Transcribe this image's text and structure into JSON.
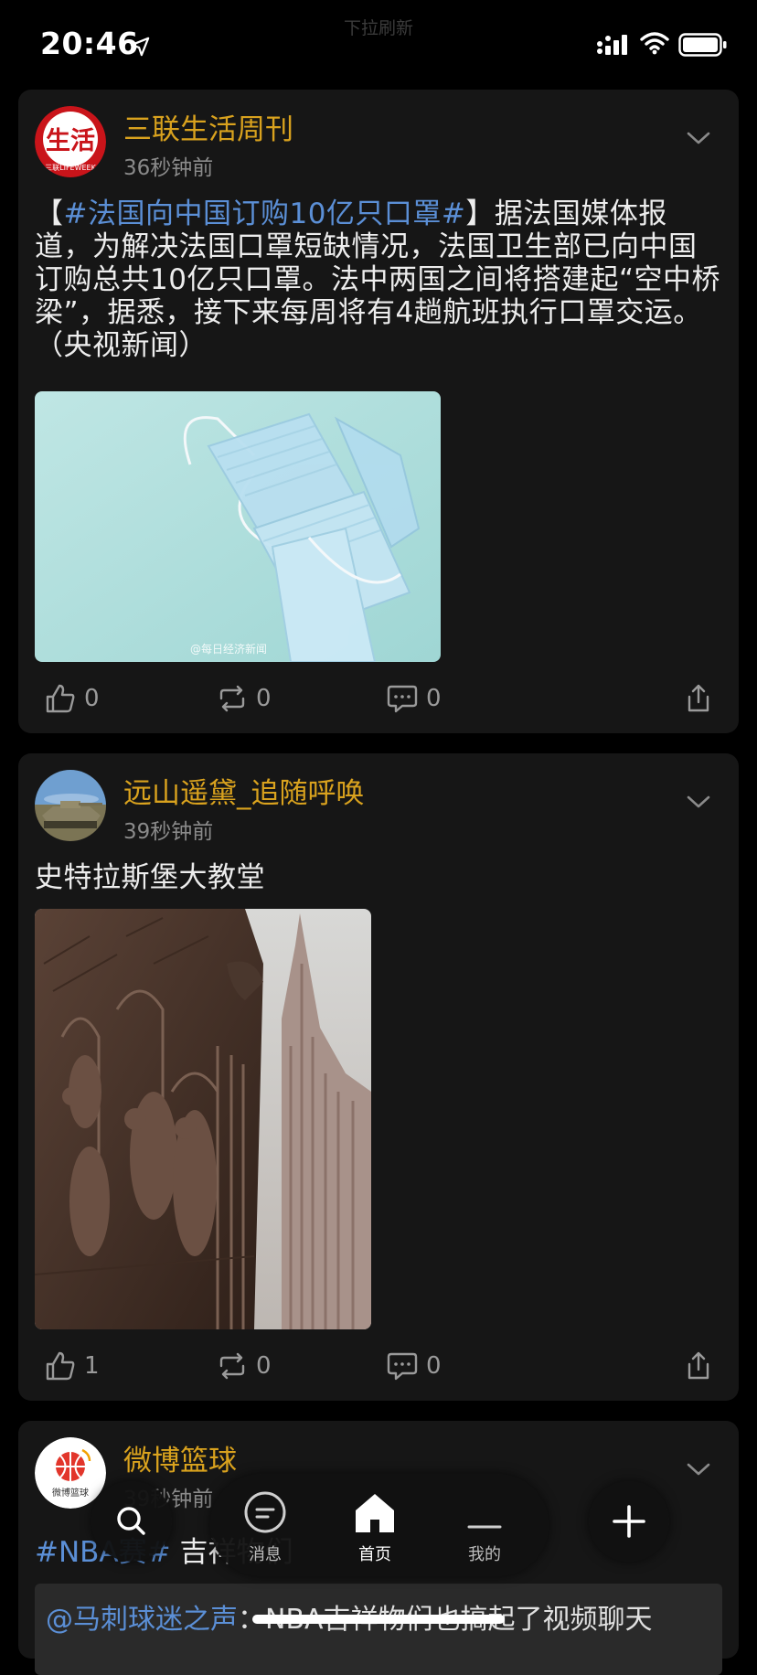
{
  "status_bar": {
    "time": "20:46",
    "pull_hint": "下拉刷新"
  },
  "posts": [
    {
      "author": "三联生活周刊",
      "time_ago": "36秒钟前",
      "avatar_text": "生活",
      "avatar_sub": "三联LIFEWEEK",
      "text_open": "【",
      "hashtag": "#法国向中国订购10亿只口罩#",
      "text_body": "】据法国媒体报道，为解决法国口罩短缺情况，法国卫生部已向中国订购总共10亿只口罩。法中两国之间将搭建起“空中桥梁”，据悉，接下来每周将有4趟航班执行口罩交运。（央视新闻）",
      "image_watermark": "@每日经济新闻",
      "likes": "0",
      "reposts": "0",
      "comments": "0"
    },
    {
      "author": "远山遥黛_追随呼唤",
      "time_ago": "39秒钟前",
      "text": "史特拉斯堡大教堂",
      "likes": "1",
      "reposts": "0",
      "comments": "0"
    },
    {
      "author": "微博篮球",
      "time_ago": "39秒钟前",
      "avatar_text": "微博篮球",
      "hashtag": "#NBA赛#",
      "text_body": "吉祥物们",
      "quote_mention": "@马刺球迷之声",
      "quote_text": "：NBA吉祥物们也搞起了视频聊天"
    }
  ],
  "tabbar": {
    "messages_label": "消息",
    "home_label": "首页",
    "me_label": "我的"
  },
  "colors": {
    "author": "#d9a21e",
    "link": "#5b8fd6",
    "card_bg": "#161616"
  }
}
